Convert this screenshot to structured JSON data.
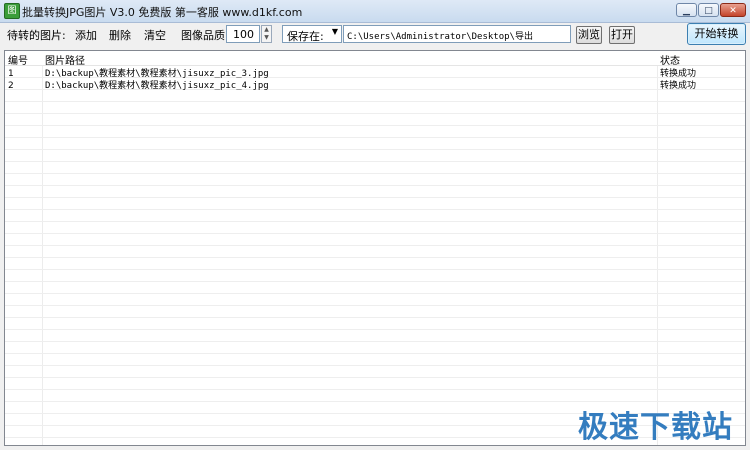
{
  "window": {
    "icon_text": "图",
    "title": "批量转换JPG图片 V3.0 免费版     第一客服 www.d1kf.com",
    "minimize_glyph": "▁",
    "maximize_glyph": "□",
    "close_glyph": "✕"
  },
  "toolbar": {
    "pending_label": "待转的图片:",
    "add_label": "添加",
    "delete_label": "删除",
    "clear_label": "清空",
    "quality_label": "图像品质:",
    "quality_value": "100",
    "save_select_value": "保存在:",
    "output_path": "C:\\Users\\Administrator\\Desktop\\导出",
    "browse_label": "浏览",
    "open_label": "打开",
    "start_label": "开始转换"
  },
  "table": {
    "columns": [
      "编号",
      "图片路径",
      "状态"
    ],
    "rows": [
      {
        "id": "1",
        "path": "D:\\backup\\教程素材\\教程素材\\jisuxz_pic_3.jpg",
        "status": "转换成功"
      },
      {
        "id": "2",
        "path": "D:\\backup\\教程素材\\教程素材\\jisuxz_pic_4.jpg",
        "status": "转换成功"
      }
    ]
  },
  "watermark": "极速下载站"
}
